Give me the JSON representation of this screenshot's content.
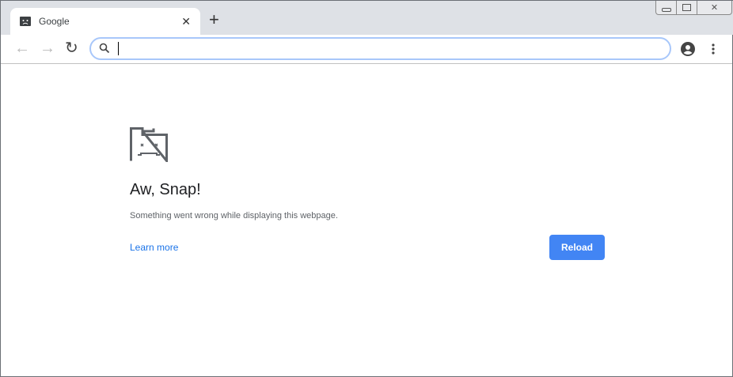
{
  "tab": {
    "title": "Google"
  },
  "omnibox": {
    "value": ""
  },
  "error": {
    "title": "Aw, Snap!",
    "message": "Something went wrong while displaying this webpage.",
    "learn_more": "Learn more",
    "reload": "Reload"
  },
  "colors": {
    "accent": "#4285f4",
    "link": "#1a73e8"
  }
}
